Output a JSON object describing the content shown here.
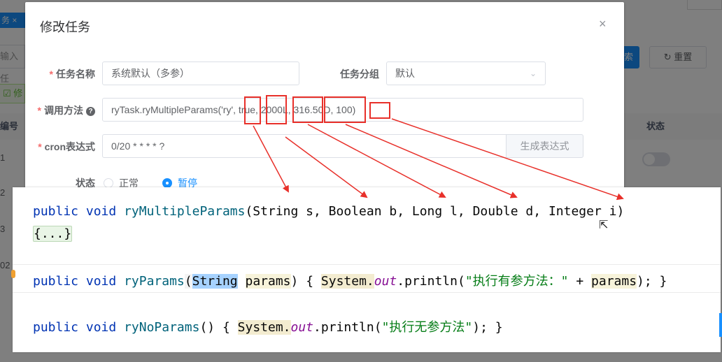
{
  "background": {
    "tab_label": "务 ×",
    "search_placeholder": "输入任",
    "edit_label": "☑ 修",
    "id_header": "编号",
    "rows": [
      "1",
      "2",
      "3",
      "02"
    ],
    "search_button": "索",
    "reset_button": "↻ 重置",
    "status_header": "状态"
  },
  "dialog": {
    "title": "修改任务",
    "close_icon": "×",
    "fields": {
      "job_name": {
        "label": "任务名称",
        "value": "系统默认（多参）"
      },
      "job_group": {
        "label": "任务分组",
        "value": "默认"
      },
      "invoke_target": {
        "label": "调用方法",
        "help": "?",
        "value": "ryTask.ryMultipleParams('ry', true, 2000L, 316.50D, 100)"
      },
      "cron": {
        "label": "cron表达式",
        "value": "0/20 * * * * ?",
        "button": "生成表达式"
      },
      "status": {
        "label": "状态",
        "options": [
          "正常",
          "暂停"
        ],
        "selected": "暂停"
      }
    }
  },
  "code": {
    "line1": {
      "kw1": "public",
      "kw2": "void",
      "name": "ryMultipleParams",
      "params": "(String s, Boolean b, Long l, Double d, Integer i)",
      "fold": "{...}"
    },
    "line2": {
      "kw1": "public",
      "kw2": "void",
      "name": "ryParams",
      "open": "(",
      "type": "String",
      "param": "params",
      "close": ") { ",
      "system": "System.",
      "out": "out",
      "call": ".println(",
      "string": "\"执行有参方法：\"",
      "concat": " + ",
      "param_ref": "params",
      "end": "); }"
    },
    "line3": {
      "kw1": "public",
      "kw2": "void",
      "name": "ryNoParams",
      "open": "() { ",
      "system": "System.",
      "out": "out",
      "call": ".println(",
      "string": "\"执行无参方法\"",
      "end": "); }"
    }
  },
  "colors": {
    "annotation_red": "#e8302a",
    "primary_blue": "#1890ff",
    "required_star": "#f56c6c"
  }
}
